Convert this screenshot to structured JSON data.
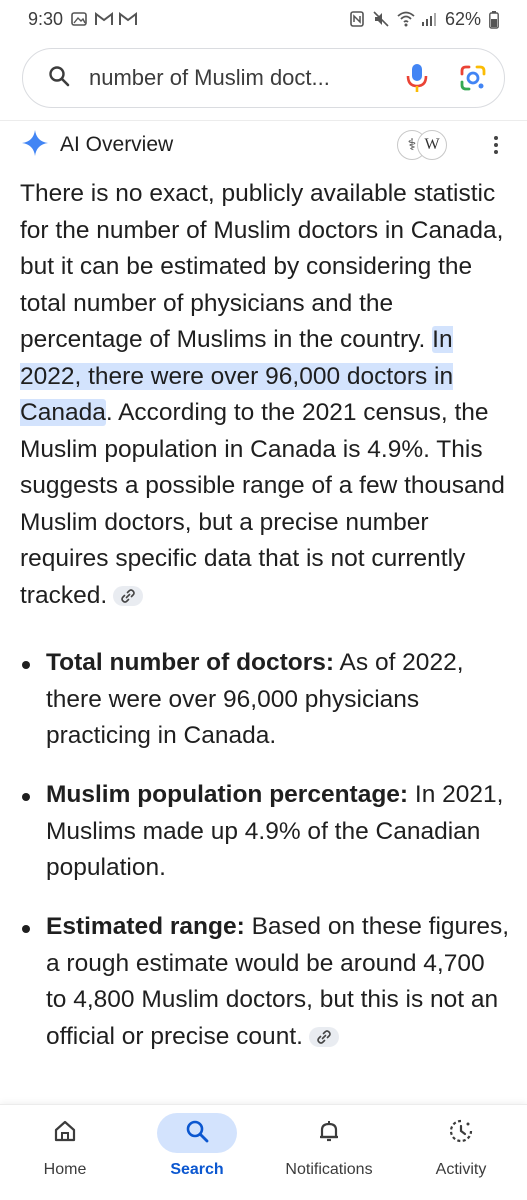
{
  "status_bar": {
    "time": "9:30",
    "battery": "62%",
    "notification_icons": [
      "gallery-icon",
      "gmail-icon",
      "gmail-icon"
    ]
  },
  "search": {
    "query": "number of Muslim doct..."
  },
  "ai_overview": {
    "title": "AI Overview",
    "sources": [
      "⚕",
      "W"
    ],
    "paragraph_before_highlight": "There is no exact, publicly available statistic for the number of Muslim doctors in Canada, but it can be estimated by considering the total number of physicians and the percentage of Muslims in the country. ",
    "highlight": "In 2022, there were over 96,000 doctors in Canada",
    "paragraph_after_highlight": ". According to the 2021 census, the Muslim population in Canada is 4.9%. This suggests a possible range of a few thousand Muslim doctors, but a precise number requires specific data that is not currently tracked.",
    "bullets": [
      {
        "heading": "Total number of doctors:",
        "text": " As of 2022, there were over 96,000 physicians practicing in Canada."
      },
      {
        "heading": "Muslim population percentage:",
        "text": " In 2021, Muslims made up 4.9% of the Canadian population."
      },
      {
        "heading": "Estimated range:",
        "text": " Based on these figures, a rough estimate would be around 4,700 to 4,800 Muslim doctors, but this is not an official or precise count."
      }
    ]
  },
  "bottom_nav": {
    "items": [
      {
        "label": "Home",
        "icon": "home-icon"
      },
      {
        "label": "Search",
        "icon": "search-icon",
        "active": true
      },
      {
        "label": "Notifications",
        "icon": "bell-icon"
      },
      {
        "label": "Activity",
        "icon": "activity-icon"
      }
    ]
  },
  "colors": {
    "accent": "#0b57d0",
    "highlight": "#d3e3fd",
    "gemini_blue": "#4285f4"
  }
}
